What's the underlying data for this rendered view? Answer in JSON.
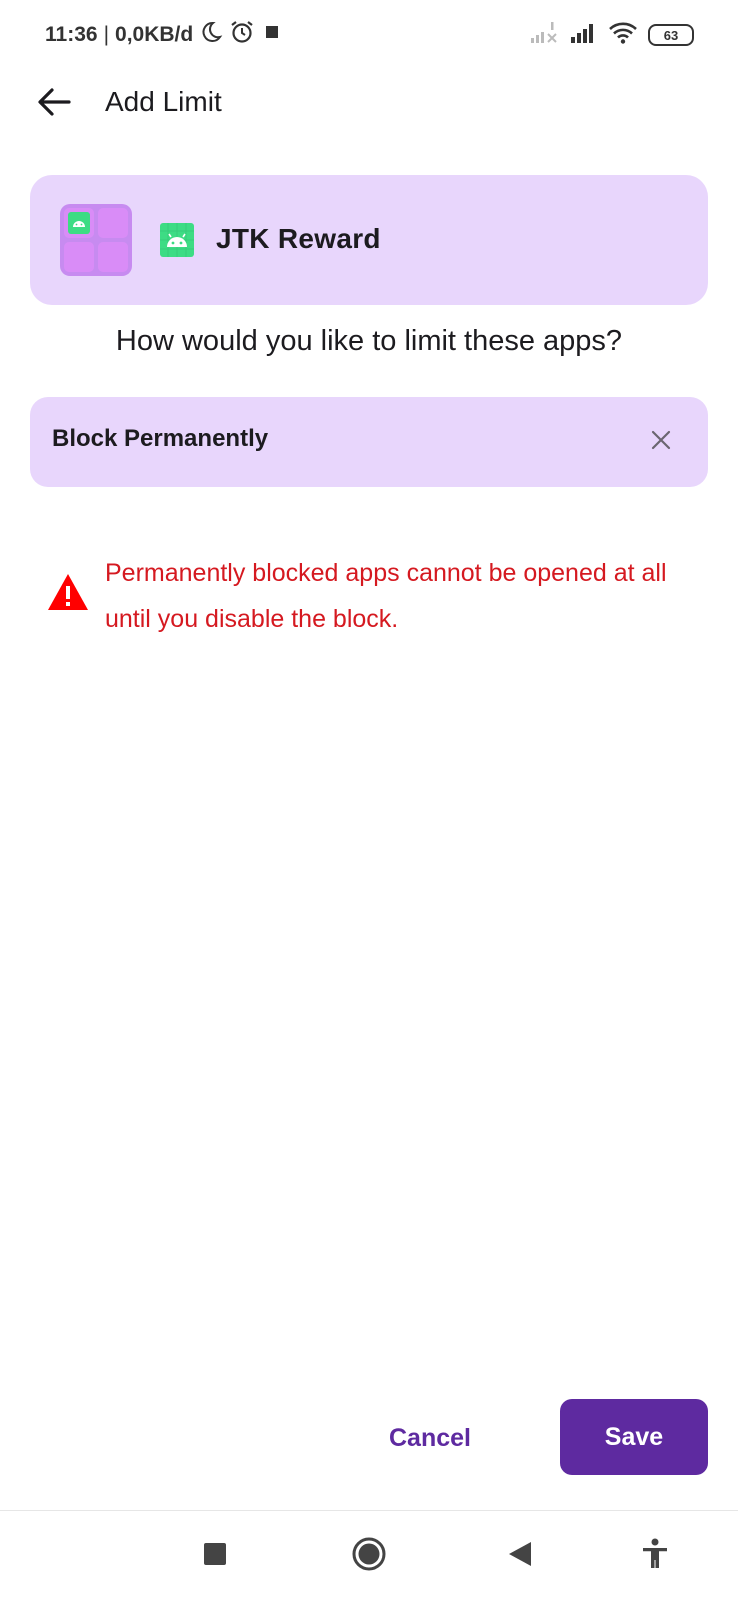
{
  "status_bar": {
    "time": "11:36",
    "separator": "|",
    "data_speed": "0,0KB/d",
    "battery_level": "63",
    "icons": [
      "moon-icon",
      "alarm-icon",
      "square-icon",
      "signal-no-service-icon",
      "signal-icon",
      "wifi-icon",
      "battery-icon"
    ]
  },
  "app_bar": {
    "title": "Add Limit",
    "back_icon": "arrow-left-icon"
  },
  "selected_apps": {
    "app_name": "JTK Reward",
    "icon": "android-icon"
  },
  "question": "How would you like to limit these apps?",
  "limit_select": {
    "value": "Block Permanently",
    "clear_icon": "close-icon"
  },
  "warning": {
    "icon": "warning-triangle-icon",
    "text": "Permanently blocked apps cannot be opened at all until you disable the block."
  },
  "actions": {
    "cancel_label": "Cancel",
    "save_label": "Save"
  },
  "nav_bar": {
    "icons": [
      "recents-icon",
      "home-icon",
      "back-icon",
      "accessibility-icon"
    ]
  },
  "colors": {
    "card_bg": "#e8d6fc",
    "primary": "#5e2aa0",
    "warning": "#d51920",
    "android_green": "#3ddc84"
  }
}
